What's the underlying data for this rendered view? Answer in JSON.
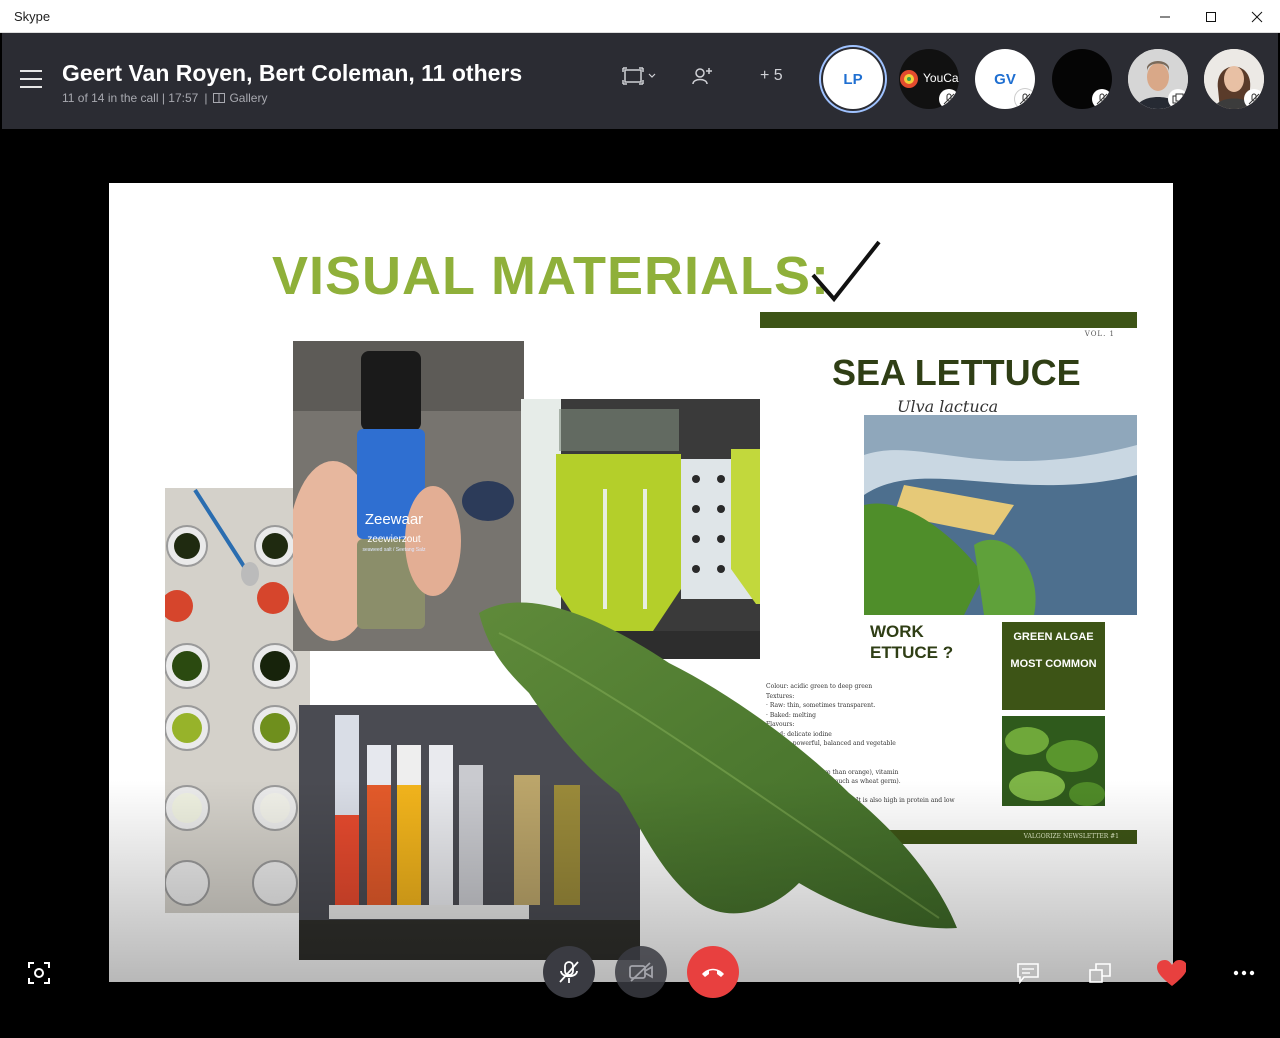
{
  "window": {
    "title": "Skype",
    "controls": [
      "minimize",
      "maximize",
      "close"
    ]
  },
  "call": {
    "title": "Geert Van Royen, Bert Coleman, 11 others",
    "status": "11 of 14 in the call | 17:57",
    "separator": "|",
    "view_mode": "Gallery",
    "more_participants": "+ 5"
  },
  "participants": [
    {
      "initials": "LP",
      "kind": "initials"
    },
    {
      "label": "YouCam",
      "kind": "video-logo",
      "muted": true
    },
    {
      "initials": "GV",
      "kind": "initials",
      "muted": true
    },
    {
      "kind": "black-video",
      "muted": true
    },
    {
      "kind": "photo-man",
      "screen_share": true
    },
    {
      "kind": "photo-woman",
      "muted": true
    }
  ],
  "slide": {
    "title": "VISUAL MATERIALS:",
    "newsletter": {
      "volume": "VOL. 1",
      "title": "SEA LETTUCE",
      "latin": "Ulva lactuca",
      "question_line1": "WORK",
      "question_line2": "ETTUCE ?",
      "box_top": "GREEN ALGAE",
      "box_bottom": "MOST COMMON",
      "body": [
        "Colour: acidic green to deep green",
        "Textures:",
        "· Raw: thin, sometimes transparent.",
        "· Baked: melting",
        "Flavours:",
        "Flood: delicate iodine",
        "Cooked: powerful, balanced and vegetable",
        "",
        "nal benefits:",
        "n C (8 times more than orange), vitamin",
        "yll), iron (twice as much as wheat germ).",
        "",
        "It is also high in protein and low"
      ],
      "footer": "VALGORIZE NEWSLETTER #1"
    },
    "jar": {
      "brand": "Zeewaar",
      "product": "zeewierzout",
      "subtitle": "seaweed salt / Seetang Salz"
    }
  },
  "colors": {
    "title_bar": "#ffffff",
    "header_bg": "#2b2c33",
    "slide_title": "#8fb03a",
    "news_green": "#3d5416",
    "end_call": "#e8403f",
    "heart": "#e8403f"
  },
  "icons": {
    "menu": "hamburger-icon",
    "switch_view": "switch-view-icon",
    "add_people": "add-people-icon",
    "snapshot": "snapshot-icon",
    "mic_off": "mic-off-icon",
    "video_off": "video-off-icon",
    "hang_up": "hang-up-icon",
    "chat": "chat-icon",
    "share_screen": "share-screen-icon",
    "react": "heart-icon",
    "more": "more-options-icon"
  }
}
